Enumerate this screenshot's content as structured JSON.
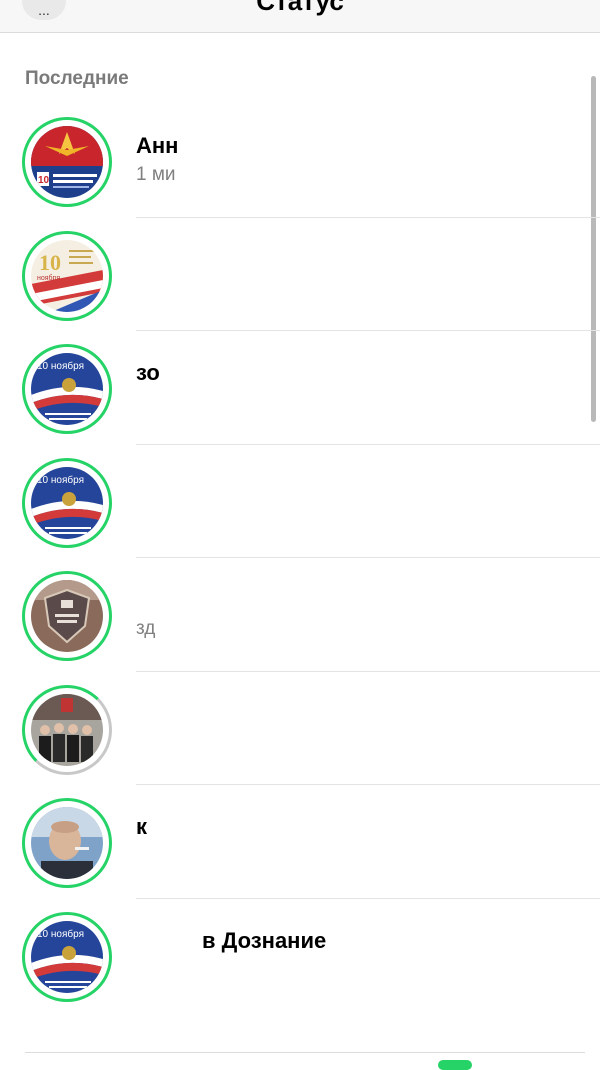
{
  "navbar": {
    "title": "Статус",
    "back_label": "..."
  },
  "section": {
    "title": "Последние"
  },
  "statuses": [
    {
      "name": "Анн",
      "time": "1 ми",
      "avatar": "holiday-poster-red"
    },
    {
      "name": "",
      "time": "",
      "avatar": "holiday-poster-10-november"
    },
    {
      "name": "зо",
      "time": "",
      "avatar": "holiday-poster-blue"
    },
    {
      "name": "",
      "time": "",
      "avatar": "holiday-poster-blue"
    },
    {
      "name": "",
      "time": "зд",
      "avatar": "police-emblem-photo"
    },
    {
      "name": "",
      "time": "",
      "avatar": "group-photo"
    },
    {
      "name": "к",
      "time": "",
      "avatar": "man-portrait"
    },
    {
      "name": "в Дознание",
      "time": "",
      "avatar": "holiday-poster-blue"
    }
  ],
  "colors": {
    "ring_new": "#25d366",
    "ring_seen": "#c8c8c8",
    "accent": "#25d366"
  }
}
